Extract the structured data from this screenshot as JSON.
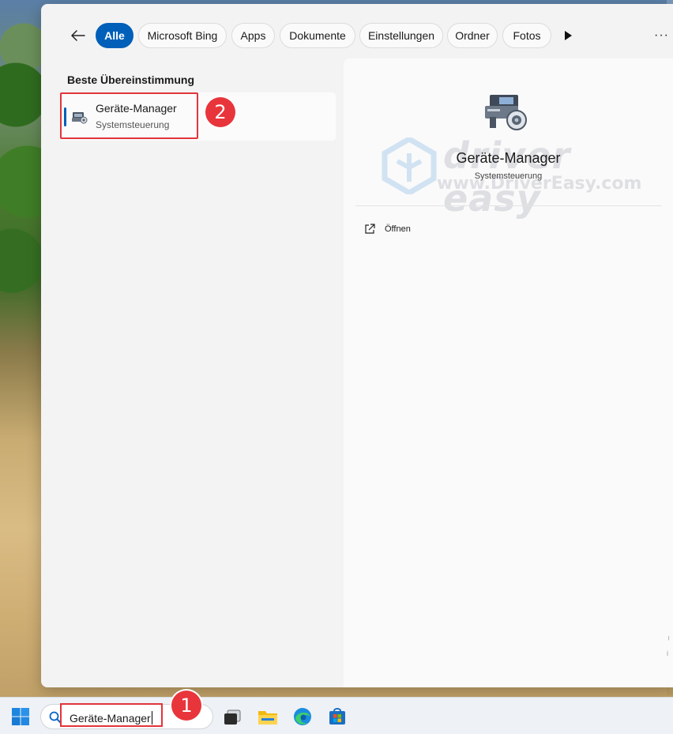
{
  "search_panel": {
    "filters": [
      {
        "label": "Alle",
        "active": true
      },
      {
        "label": "Microsoft Bing",
        "active": false
      },
      {
        "label": "Apps",
        "active": false
      },
      {
        "label": "Dokumente",
        "active": false
      },
      {
        "label": "Einstellungen",
        "active": false
      },
      {
        "label": "Ordner",
        "active": false
      },
      {
        "label": "Fotos",
        "active": false
      }
    ],
    "back_icon": "arrow-left-icon",
    "more_filters_icon": "play-right-icon",
    "more_options_label": "···"
  },
  "best_match": {
    "section_title": "Beste Übereinstimmung",
    "item": {
      "title": "Geräte-Manager",
      "subtitle": "Systemsteuerung",
      "icon": "device-manager-icon"
    }
  },
  "detail": {
    "title": "Geräte-Manager",
    "subtitle": "Systemsteuerung",
    "icon": "device-manager-icon",
    "actions": [
      {
        "label": "Öffnen",
        "icon": "open-external-icon"
      }
    ],
    "watermark": {
      "brand": "driver easy",
      "url": "www.DriverEasy.com"
    }
  },
  "taskbar": {
    "search_value": "Geräte-Manager",
    "apps": [
      "windows-start-icon",
      "task-view-icon",
      "file-explorer-icon",
      "edge-browser-icon",
      "microsoft-store-icon"
    ]
  },
  "annotations": {
    "step1": "1",
    "step2": "2",
    "color": "#e8353b"
  },
  "colors": {
    "accent": "#005fb8",
    "highlight": "#e2343b"
  }
}
